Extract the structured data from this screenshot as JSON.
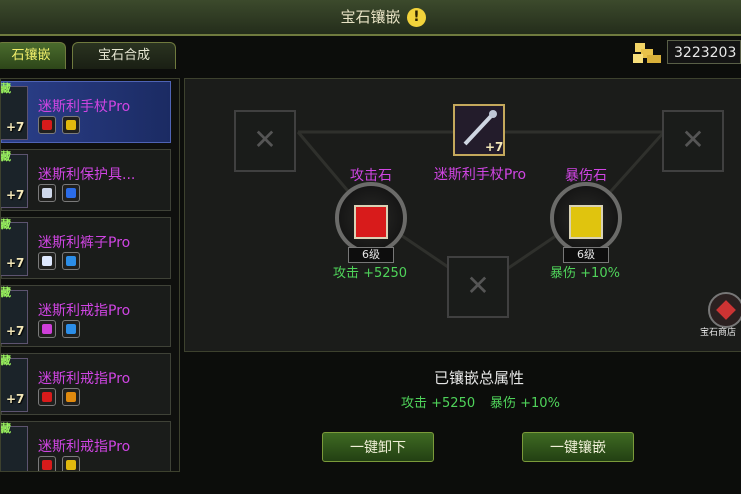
{
  "header": {
    "title": "宝石镶嵌"
  },
  "tabs": [
    {
      "label": "石镶嵌"
    },
    {
      "label": "宝石合成"
    }
  ],
  "gold": {
    "amount": "3223203"
  },
  "equipment_list": [
    {
      "tag": "藏",
      "level": "+7",
      "name": "迷斯利手杖Pro",
      "gem1": "#d81b1b",
      "gem2": "#e0b80e"
    },
    {
      "tag": "藏",
      "level": "+7",
      "name": "迷斯利保护具...",
      "gem1": "#cfd8ea",
      "gem2": "#2b6ce8"
    },
    {
      "tag": "藏",
      "level": "+7",
      "name": "迷斯利裤子Pro",
      "gem1": "#dfe9ff",
      "gem2": "#2c8ee8"
    },
    {
      "tag": "藏",
      "level": "+7",
      "name": "迷斯利戒指Pro",
      "gem1": "#cf3fd9",
      "gem2": "#2c8ee8"
    },
    {
      "tag": "藏",
      "level": "+7",
      "name": "迷斯利戒指Pro",
      "gem1": "#d81b1b",
      "gem2": "#e08a0e"
    },
    {
      "tag": "藏",
      "level": "",
      "name": "迷斯利戒指Pro",
      "gem1": "#d81b1b",
      "gem2": "#e0b80e"
    }
  ],
  "center": {
    "name": "迷斯利手杖Pro",
    "level": "+7"
  },
  "gem_left": {
    "name": "攻击石",
    "level": "6级",
    "stat": "攻击 +5250",
    "color": "#d81b1b"
  },
  "gem_right": {
    "name": "暴伤石",
    "level": "6级",
    "stat": "暴伤 +10%",
    "color": "#e0c40e"
  },
  "totals": {
    "title": "已镶嵌总属性",
    "atk": "攻击 +5250",
    "crit": "暴伤 +10%"
  },
  "buttons": {
    "unmount": "一键卸下",
    "mount": "一键镶嵌"
  },
  "shop": {
    "label": "宝石商店"
  },
  "colors": {
    "accent": "#4fd35a",
    "item_name": "#cf45e2",
    "tab_active": "#f2f06b"
  }
}
